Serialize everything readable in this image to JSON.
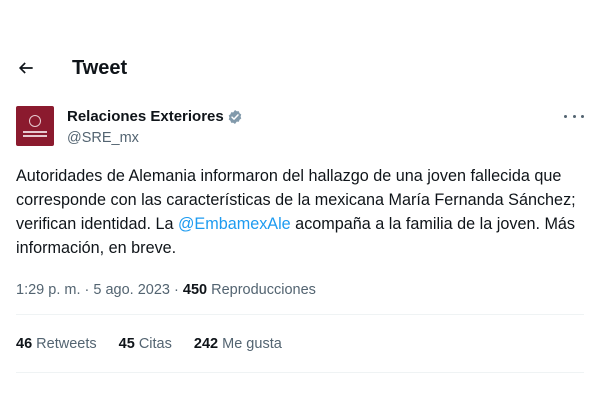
{
  "header": {
    "title": "Tweet",
    "back_icon": "arrow-left-icon"
  },
  "author": {
    "display_name": "Relaciones Exteriores",
    "handle": "@SRE_mx",
    "verified_icon": "verified-badge-icon",
    "more_icon": "more-options-icon",
    "avatar_color": "#8b1a2e"
  },
  "tweet": {
    "text_part1": "Autoridades de Alemania informaron del hallazgo de una joven fallecida que corresponde con las características de la mexicana María Fernanda Sánchez; verifican identidad. La ",
    "mention": "@EmbamexAle",
    "text_part2": " acompaña a la familia de la joven. Más información, en breve."
  },
  "meta": {
    "time": "1:29 p. m.",
    "separator": " · ",
    "date": "5 ago. 2023",
    "views_count": "450",
    "views_label": "Reproducciones"
  },
  "stats": {
    "retweets_count": "46",
    "retweets_label": "Retweets",
    "quotes_count": "45",
    "quotes_label": "Citas",
    "likes_count": "242",
    "likes_label": "Me gusta"
  },
  "colors": {
    "link": "#1d9bf0",
    "secondary_text": "#536471",
    "primary_text": "#0f1419"
  }
}
